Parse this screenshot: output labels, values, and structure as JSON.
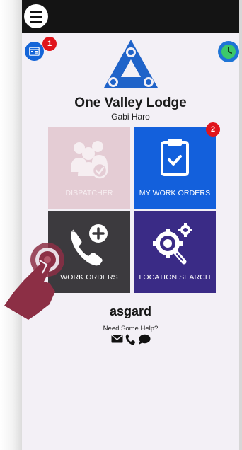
{
  "app": {
    "org_title": "One Valley Lodge",
    "user_name": "Gabi Haro",
    "menu_icon": "hamburger-menu-icon"
  },
  "header": {
    "calendar_badge": "1",
    "calendar_icon": "calendar-icon",
    "clock_icon": "clock-icon"
  },
  "tiles": [
    {
      "label": "DISPATCHER",
      "icon": "people-check-icon",
      "state": "disabled",
      "color": "#e4ccd4"
    },
    {
      "label": "MY WORK ORDERS",
      "icon": "clipboard-check-icon",
      "badge": "2",
      "color": "#1360dc"
    },
    {
      "label": "WORK ORDERS",
      "icon": "phone-plus-icon",
      "color": "#3c3a3e"
    },
    {
      "label": "LOCATION SEARCH",
      "icon": "gear-search-icon",
      "color": "#3a2b86"
    }
  ],
  "footer": {
    "company": "asgard",
    "help_text": "Need Some Help?",
    "contact_icons": [
      "envelope-icon",
      "phone-icon",
      "chat-bubble-icon"
    ]
  },
  "colors": {
    "topbar": "#141414",
    "accent_blue": "#1360dc",
    "badge_red": "#e0141c",
    "clock_green": "#3cc86a",
    "tap_hand": "#8c2f45"
  }
}
